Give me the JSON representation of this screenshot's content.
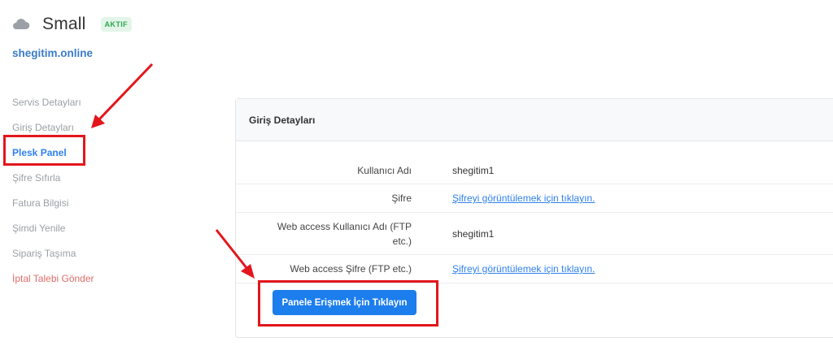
{
  "header": {
    "product_name": "Small",
    "status_badge": "AKTIF",
    "domain": "shegitim.online",
    "icon": "cloud-icon"
  },
  "sidebar": {
    "items": [
      {
        "label": "Servis Detayları",
        "state": "default"
      },
      {
        "label": "Giriş Detayları",
        "state": "default"
      },
      {
        "label": "Plesk Panel",
        "state": "active"
      },
      {
        "label": "Şifre Sıfırla",
        "state": "default"
      },
      {
        "label": "Fatura Bilgisi",
        "state": "default"
      },
      {
        "label": "Şimdi Yenile",
        "state": "default"
      },
      {
        "label": "Sipariş Taşıma",
        "state": "default"
      },
      {
        "label": "İptal Talebi Gönder",
        "state": "danger"
      }
    ]
  },
  "panel": {
    "title": "Giriş Detayları",
    "rows": [
      {
        "label": "Kullanıcı Adı",
        "value": "shegitim1"
      },
      {
        "label": "Şifre",
        "value": "Şifreyi görüntülemek için tıklayın."
      },
      {
        "label": "Web access Kullanıcı Adı (FTP etc.)",
        "value": "shegitim1"
      },
      {
        "label": "Web access Şifre (FTP etc.)",
        "value": "Şifreyi görüntülemek için tıklayın."
      }
    ],
    "button_label": "Panele Erişmek İçin Tıklayın"
  },
  "colors": {
    "accent": "#2f80ed",
    "button": "#1c7ded",
    "badge_text": "#2fa84f",
    "badge_bg": "#e3f5e8",
    "danger": "#e06c6c",
    "annotation": "#e3161c"
  }
}
